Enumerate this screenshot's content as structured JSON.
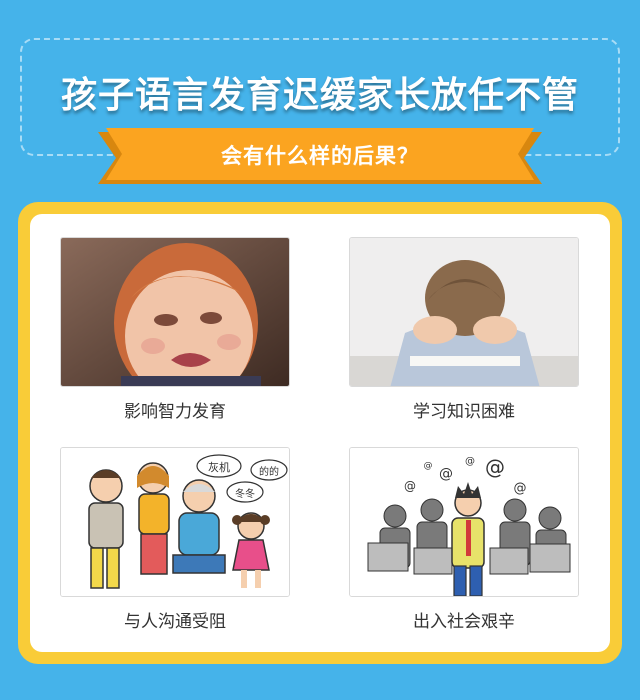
{
  "header": {
    "title": "孩子语言发育迟缓家长放任不管",
    "subtitle": "会有什么样的后果？"
  },
  "colors": {
    "background": "#45b3ea",
    "ribbon": "#fba420",
    "frame": "#f9cc38",
    "card": "#ffffff"
  },
  "consequences": [
    {
      "label": "影响智力发育",
      "image": "crying-toddler-photo"
    },
    {
      "label": "学习知识困难",
      "image": "boy-head-down-at-desk-photo"
    },
    {
      "label": "与人沟通受阻",
      "image": "family-cartoon-illustration"
    },
    {
      "label": "出入社会艰辛",
      "image": "stressed-office-worker-illustration"
    }
  ],
  "illustration_text": {
    "bubble_1": "灰机",
    "bubble_2": "的的",
    "bubble_3": "冬冬",
    "symbol": "@"
  }
}
